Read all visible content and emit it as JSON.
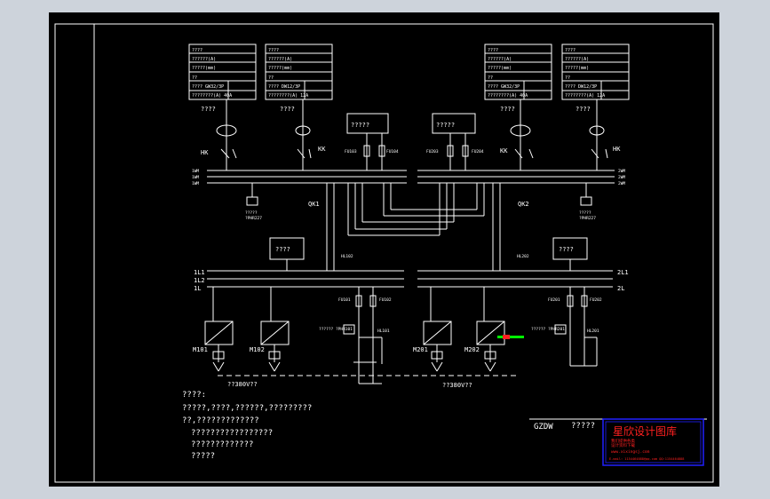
{
  "colors": {
    "window_bg": "#cdd3db",
    "sheet_bg": "#000000",
    "line": "#ffffff",
    "stamp_red": "#ff2020",
    "stamp_blue": "#2020ff",
    "green_mark": "#00ff00"
  },
  "tables": [
    {
      "rows": [
        "????",
        "??????(A)",
        "?????(mm)",
        "??",
        "????  GW32/3P",
        "????????(A)   40A"
      ]
    },
    {
      "rows": [
        "????",
        "??????(A)",
        "?????(mm)",
        "??",
        "????  DW12/3P",
        "????????(A)   12A"
      ]
    },
    {
      "rows": [
        "????",
        "??????(A)",
        "?????(mm)",
        "??",
        "????  GW32/3P",
        "????????(A)   40A"
      ]
    },
    {
      "rows": [
        "????",
        "??????(A)",
        "?????(mm)",
        "??",
        "????  DW12/3P",
        "????????(A)   12A"
      ]
    }
  ],
  "table_captions": [
    "????",
    "????",
    "????",
    "????"
  ],
  "labels": {
    "hk_left": "HK",
    "kk_left": "KK",
    "kk_right": "KK",
    "hk_right": "HK",
    "box_top_left": "?????",
    "box_top_right": "?????",
    "fu_1": "FU103",
    "fu_2": "FU104",
    "fu_3": "FU203",
    "fu_4": "FU204",
    "bus_l1": "1WM",
    "bus_l2": "1WM",
    "bus_l3": "1WM",
    "bus_r1": "2WM",
    "bus_r2": "2WM",
    "bus_r3": "2WM",
    "qk1": "QK1",
    "qk2": "QK2",
    "relay_left": "?????",
    "relay_left_2": "?PHR227",
    "relay_right": "?????",
    "relay_right_2": "?PHR227",
    "box_mid_left": "????",
    "box_mid_right": "????",
    "hl_left": "HL102",
    "hl_right": "HL202",
    "bus2_l1": "1L1",
    "bus2_l2": "1L2",
    "bus2_l3": "1L",
    "bus2_r1": "2L1",
    "bus2_r2": "2L",
    "fu_101": "FU101",
    "fu_102": "FU102",
    "fu_201": "FU201",
    "fu_202": "FU202",
    "m101": "M101",
    "m102": "M102",
    "m201": "M201",
    "m202": "M202",
    "ctl_left": "?????? ?PHR101",
    "ctl_right": "?????? ?PHR201",
    "hl_101": "HL101",
    "hl_201": "HL201",
    "voltage_left": "??380V??",
    "voltage_right": "??380V??"
  },
  "notes": [
    "????:",
    "?????,????,??????,?????????",
    "??,?????????????",
    "?????????????????",
    "?????????????",
    "?????"
  ],
  "title_block": {
    "code": "GZDW",
    "name": "?????"
  },
  "stamp": {
    "title": "星欣设计图库",
    "line1": "我们提供各类",
    "line2": "设计资料下载",
    "line3": "www.xixingsj.com",
    "line4": "E-mail: 1154464888@qq.com  QQ:1154464888"
  }
}
